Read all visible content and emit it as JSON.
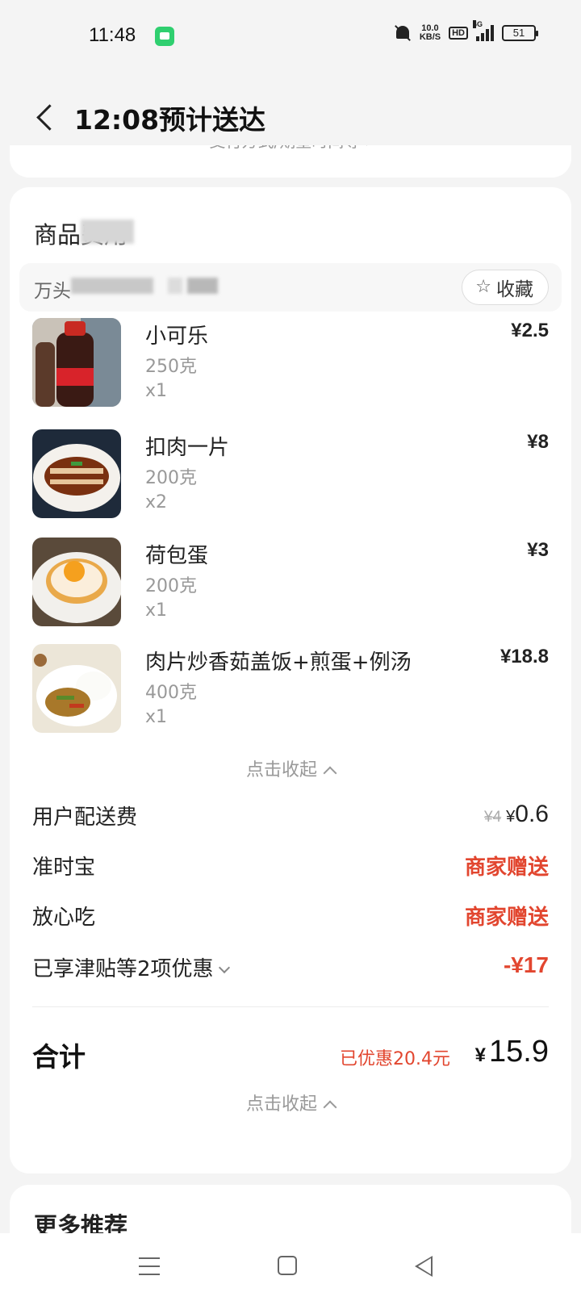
{
  "status_bar": {
    "time": "11:48",
    "net_speed_value": "10.0",
    "net_speed_unit": "KB/S",
    "hd": "HD",
    "network": "4G",
    "battery": "51"
  },
  "header": {
    "title": "12:08预计送达"
  },
  "top_card": {
    "partial_text": "支付方式/期望时间等 ›"
  },
  "goods": {
    "section_title": "商品费用",
    "shop_name": "万头",
    "favorite_label": "收藏",
    "items": [
      {
        "name": "小可乐",
        "weight": "250克",
        "qty": "x1",
        "price": "¥2.5"
      },
      {
        "name": "扣肉一片",
        "weight": "200克",
        "qty": "x2",
        "price": "¥8"
      },
      {
        "name": "荷包蛋",
        "weight": "200克",
        "qty": "x1",
        "price": "¥3"
      },
      {
        "name": "肉片炒香茹盖饭+煎蛋+例汤",
        "weight": "400克",
        "qty": "x1",
        "price": "¥18.8"
      }
    ],
    "collapse_label": "点击收起"
  },
  "fees": {
    "delivery_label": "用户配送费",
    "delivery_original": "¥4",
    "delivery_currency": "¥",
    "delivery_value": "0.6",
    "ontime_label": "准时宝",
    "ontime_value": "商家赠送",
    "safe_label": "放心吃",
    "safe_value": "商家赠送",
    "discount_label": "已享津贴等2项优惠",
    "discount_value": "-¥17"
  },
  "total": {
    "label": "合计",
    "discount_text": "已优惠20.4元",
    "currency": "¥",
    "value": "15.9",
    "collapse_label": "点击收起"
  },
  "recommend": {
    "title": "更多推荐"
  },
  "colors": {
    "accent_red": "#e2462f",
    "background": "#f4f4f4"
  }
}
